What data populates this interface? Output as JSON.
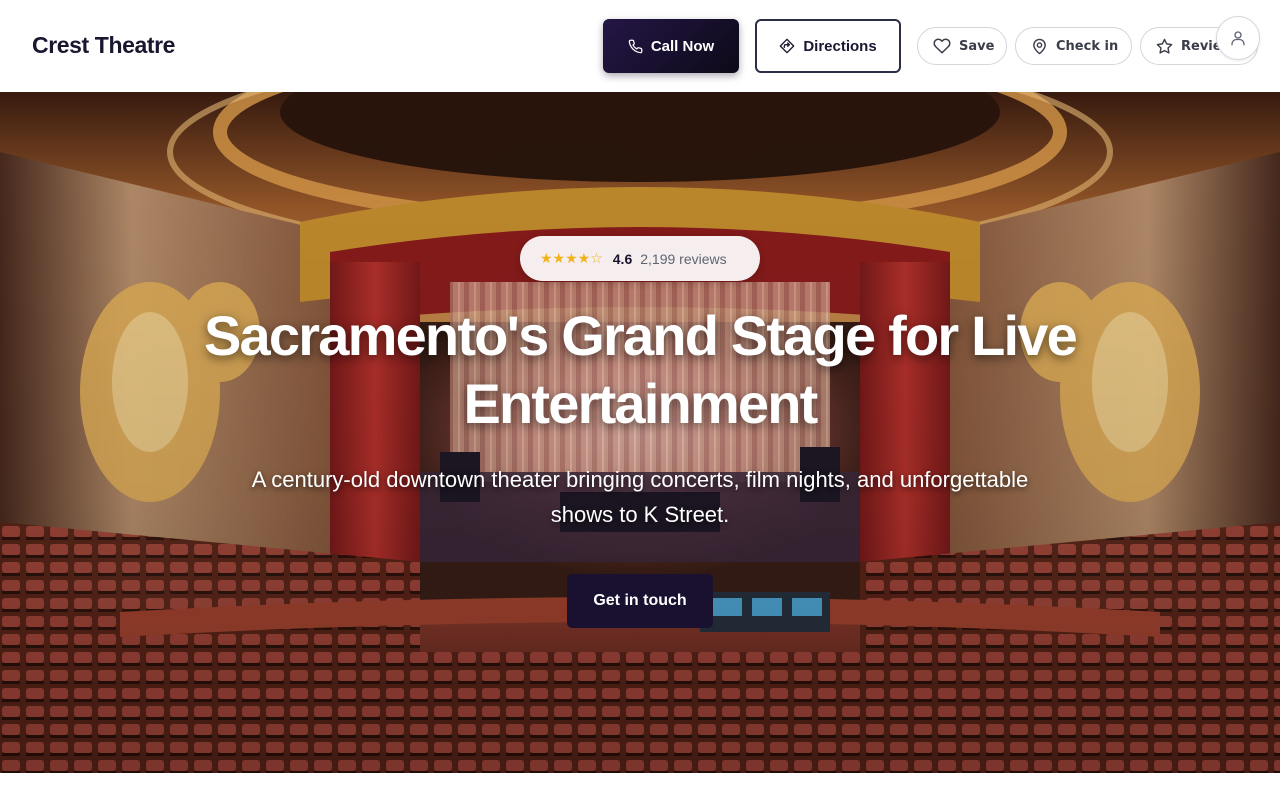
{
  "header": {
    "brand": "Crest Theatre",
    "call_label": "Call Now",
    "directions_label": "Directions",
    "save_label": "Save",
    "checkin_label": "Check in",
    "review_label": "Review",
    "icons": {
      "call": "phone-icon",
      "directions": "directions-icon",
      "save": "heart-icon",
      "checkin": "map-pin-icon",
      "review": "star-icon",
      "account": "user-icon"
    }
  },
  "hero": {
    "rating": {
      "stars": "★★★★☆",
      "value": "4.6",
      "count": "2,199 reviews"
    },
    "title": "Sacramento's Grand Stage for Live Entertainment",
    "subtitle": "A century-old downtown theater bringing concerts, film nights, and unforgettable shows to K Street.",
    "cta_label": "Get in touch"
  },
  "colors": {
    "brand_dark": "#1a1030",
    "star": "#f2b21b",
    "text_dark": "#1b1530"
  }
}
